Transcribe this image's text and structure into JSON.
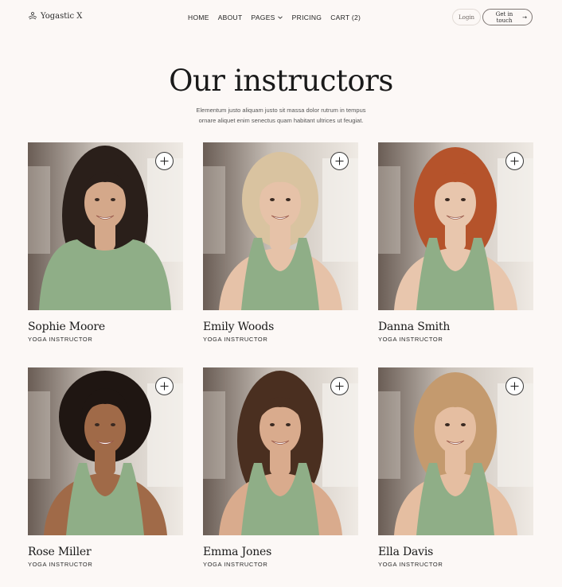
{
  "brand": {
    "name": "Yogastic X",
    "icon": "lotus-icon"
  },
  "nav": {
    "home": "HOME",
    "about": "ABOUT",
    "pages": "PAGES",
    "pricing": "PRICING",
    "cart": "CART (2)"
  },
  "header_buttons": {
    "login": "Login",
    "touch": "Get in touch",
    "touch_arrow": "→"
  },
  "hero": {
    "title": "Our instructors",
    "subtitle_line1": "Elementum justo aliquam justo sit massa dolor rutrum in tempus",
    "subtitle_line2": "ornare aliquet enim senectus quam habitant ultrices ut feugiat."
  },
  "colors": {
    "background": "#fcf8f6",
    "top_green": "#8fae87",
    "text": "#1e1e1e"
  },
  "instructors": [
    {
      "name": "Sophie Moore",
      "role": "YOGA INSTRUCTOR",
      "hair": "#2a1f1a",
      "skin": "#d4a88a",
      "style": "long-dark"
    },
    {
      "name": "Emily Woods",
      "role": "YOGA INSTRUCTOR",
      "hair": "#d9c3a0",
      "skin": "#e6c2a8",
      "style": "blonde-bob"
    },
    {
      "name": "Danna Smith",
      "role": "YOGA INSTRUCTOR",
      "hair": "#b5532b",
      "skin": "#e8c6ad",
      "style": "red-curly"
    },
    {
      "name": "Rose Miller",
      "role": "YOGA INSTRUCTOR",
      "hair": "#1f1612",
      "skin": "#a06a48",
      "style": "afro"
    },
    {
      "name": "Emma Jones",
      "role": "YOGA INSTRUCTOR",
      "hair": "#4a2f20",
      "skin": "#d9ab8d",
      "style": "brown-wavy"
    },
    {
      "name": "Ella Davis",
      "role": "YOGA INSTRUCTOR",
      "hair": "#c49a6e",
      "skin": "#e5bea1",
      "style": "light-curly"
    }
  ]
}
